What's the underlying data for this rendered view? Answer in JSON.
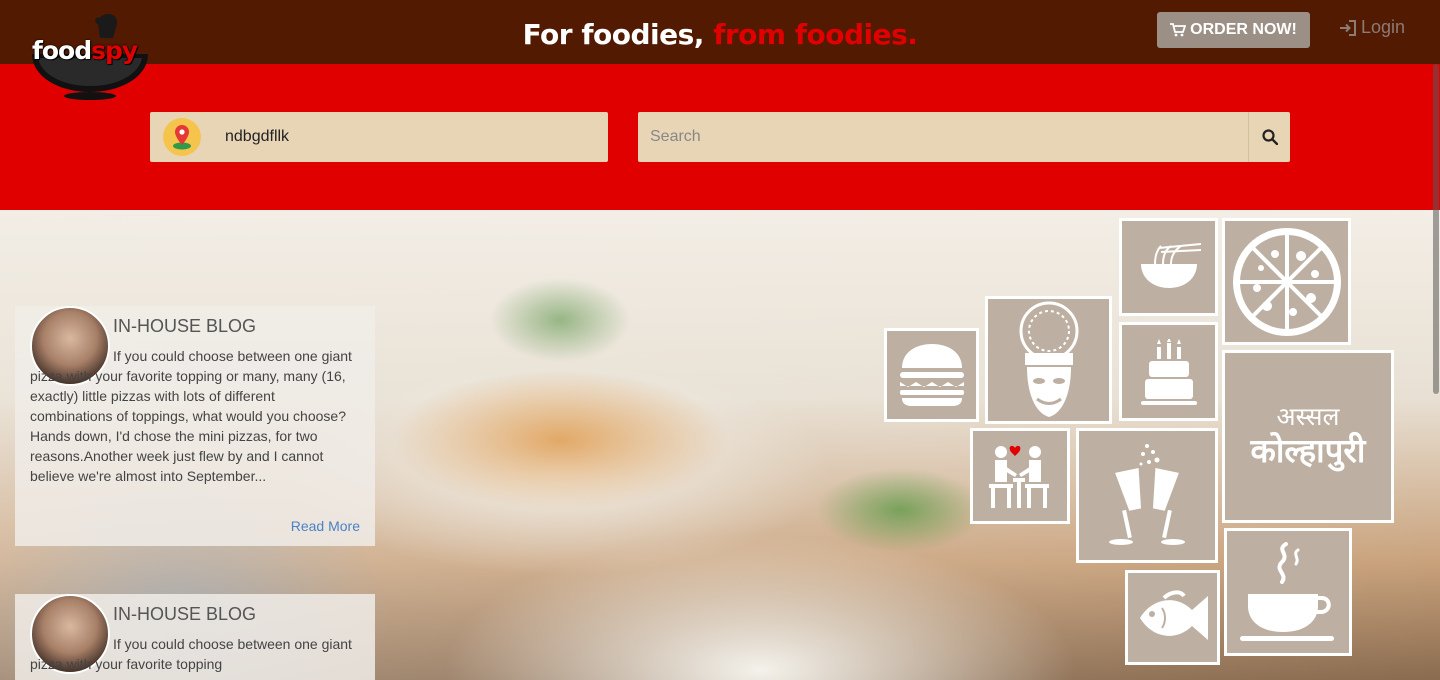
{
  "header": {
    "logo_food": "food",
    "logo_spy": "spy",
    "tagline_main": "For foodies, ",
    "tagline_accent": "from foodies.",
    "order_button": "ORDER NOW!",
    "order_icon": "cart-icon",
    "login_label": "Login",
    "login_icon": "login-icon"
  },
  "search": {
    "location_value": "ndbgdfllk",
    "location_icon": "map-pin-icon",
    "placeholder": "Search",
    "search_icon": "search-icon"
  },
  "blog": [
    {
      "title": "IN-HOUSE BLOG",
      "excerpt": "If you could choose between one giant pizza with your favorite topping or many, many (16, exactly) little pizzas with lots of different combinations of toppings, what would you choose? Hands down, I'd chose the mini pizzas, for two reasons.Another week just flew by and I cannot believe we're almost into September...",
      "read_more": "Read More"
    },
    {
      "title": "IN-HOUSE BLOG",
      "excerpt": "If you could choose between one giant pizza with your favorite topping"
    }
  ],
  "tiles": {
    "kolhapuri_line1": "अस्सल",
    "kolhapuri_line2": "कोल्हापुरी",
    "icons": [
      "noodles-icon",
      "pizza-icon",
      "burger-icon",
      "kathakali-icon",
      "cake-icon",
      "kolhapuri-tile",
      "couple-date-icon",
      "champagne-icon",
      "fish-icon",
      "coffee-cup-icon"
    ]
  },
  "colors": {
    "topbar": "#521a00",
    "brand_red": "#e00000",
    "input_bg": "#e8d5b5",
    "tile_bg": "#bdb0a2",
    "link_blue": "#4a82c5"
  }
}
